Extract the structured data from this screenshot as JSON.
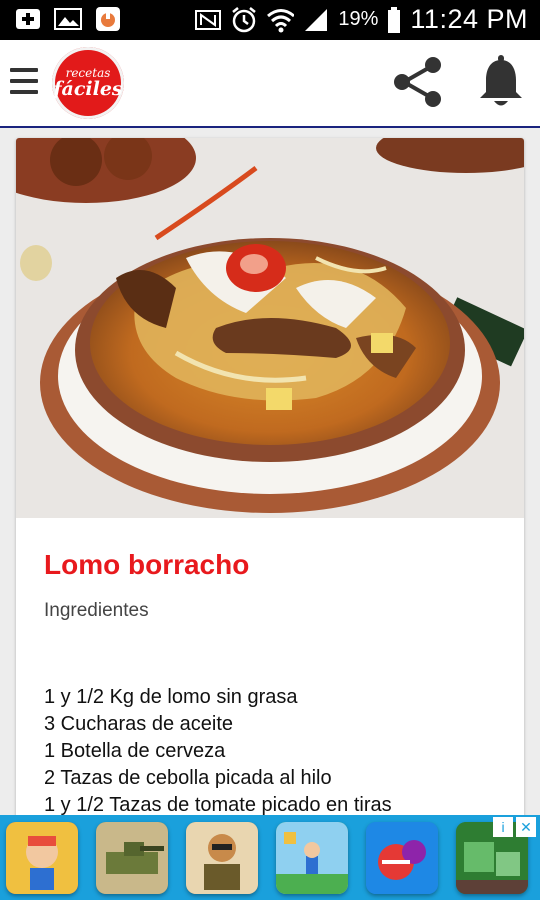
{
  "status_bar": {
    "battery_percent": "19%",
    "time": "11:24 PM",
    "icons": [
      "add-icon",
      "image-icon",
      "app-notification-icon",
      "nfc-icon",
      "alarm-icon",
      "wifi-icon",
      "signal-icon",
      "battery-icon"
    ]
  },
  "app_bar": {
    "logo_line1": "recetas",
    "logo_line2": "fáciles",
    "icons": [
      "menu-icon",
      "share-icon",
      "bell-icon"
    ]
  },
  "recipe": {
    "title": "Lomo borracho",
    "section": "Ingredientes",
    "ingredients": [
      "1 y 1/2 Kg de lomo sin grasa",
      "3 Cucharas de aceite",
      "1 Botella de cerveza",
      "2 Tazas de cebolla picada al hilo",
      "1 y 1/2 Tazas de tomate picado en tiras"
    ]
  },
  "ad_banner": {
    "info_label": "i",
    "close_label": "✕",
    "tile_colors": [
      "#e84d3c",
      "#6b7a3a",
      "#c88a4a",
      "#4caf50",
      "#1e88e5",
      "#2e7d32"
    ]
  },
  "colors": {
    "accent_red": "#e8191d",
    "appbar_underline": "#1a237e",
    "ad_background": "#1aa0dc"
  }
}
